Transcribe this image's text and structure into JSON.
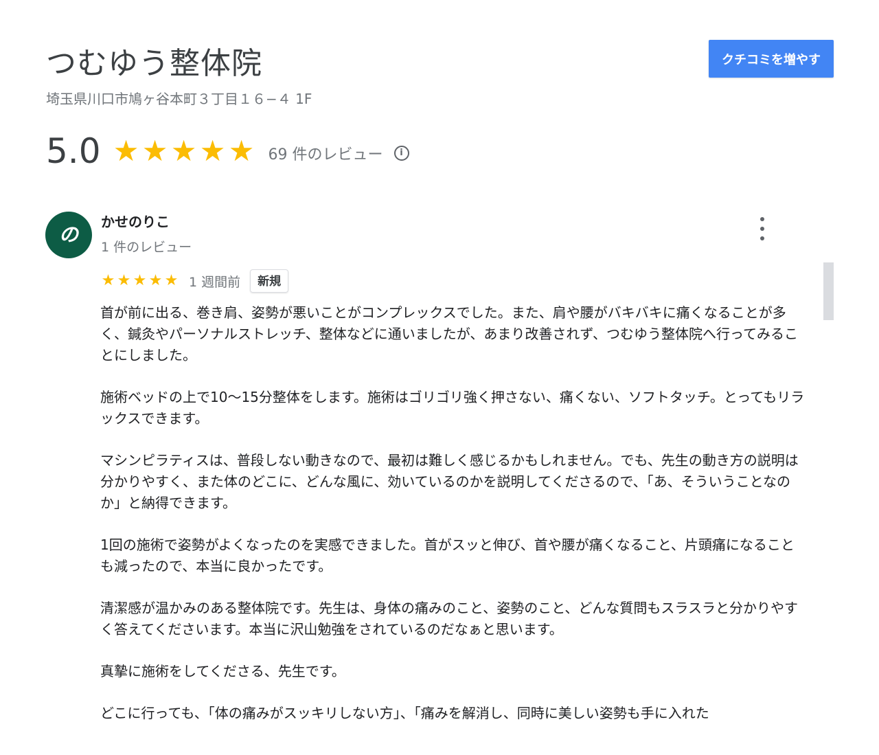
{
  "business": {
    "name": "つむゆう整体院",
    "address": "埼玉県川口市鳩ヶ谷本町３丁目１６−４ 1F",
    "rating": "5.0",
    "stars": 5,
    "review_count": "69 件のレビュー"
  },
  "icons": {
    "info": "info-icon",
    "more": "more-vert-icon",
    "star": "star-icon"
  },
  "cta": {
    "label": "クチコミを増やす"
  },
  "colors": {
    "accent": "#4285f4",
    "star": "#fbbc04",
    "avatar_bg": "#0d5c45"
  },
  "review": {
    "avatar_letter": "の",
    "reviewer_name": "かせのりこ",
    "reviewer_meta": "1 件のレビュー",
    "stars": 5,
    "date": "1 週間前",
    "badge": "新規",
    "paragraphs": [
      "首が前に出る、巻き肩、姿勢が悪いことがコンプレックスでした。また、肩や腰がバキバキに痛くなることが多く、鍼灸やパーソナルストレッチ、整体などに通いましたが、あまり改善されず、つむゆう整体院へ行ってみることにしました。",
      "施術ベッドの上で10〜15分整体をします。施術はゴリゴリ強く押さない、痛くない、ソフトタッチ。とってもリラックスできます。",
      "マシンピラティスは、普段しない動きなので、最初は難しく感じるかもしれません。でも、先生の動き方の説明は分かりやすく、また体のどこに、どんな風に、効いているのかを説明してくださるので、「あ、そういうことなのか」と納得できます。",
      "1回の施術で姿勢がよくなったのを実感できました。首がスッと伸び、首や腰が痛くなること、片頭痛になることも減ったので、本当に良かったです。",
      "清潔感が温かみのある整体院です。先生は、身体の痛みのこと、姿勢のこと、どんな質問もスラスラと分かりやすく答えてくださいます。本当に沢山勉強をされているのだなぁと思います。",
      "真摯に施術をしてくださる、先生です。",
      "どこに行っても、「体の痛みがスッキリしない方」、「痛みを解消し、同時に美しい姿勢も手に入れた"
    ]
  }
}
